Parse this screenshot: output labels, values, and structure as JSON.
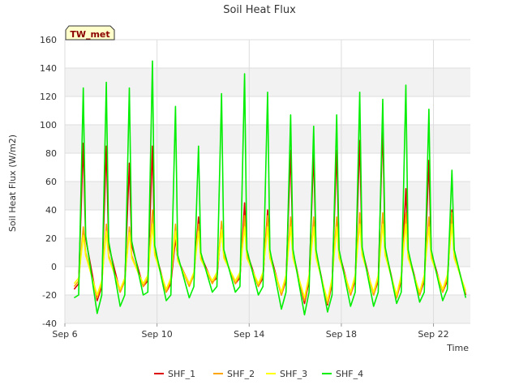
{
  "chart_data": {
    "type": "line",
    "title": "Soil Heat Flux",
    "xlabel": "Time",
    "ylabel": "Soil Heat Flux (W/m2)",
    "badge": "TW_met",
    "ylim": [
      -40,
      160
    ],
    "yticks": [
      -40,
      -20,
      0,
      20,
      40,
      60,
      80,
      100,
      120,
      140,
      160
    ],
    "xlim": [
      "Sep 6",
      "Sep 23.6"
    ],
    "xticks": [
      "Sep 6",
      "Sep 10",
      "Sep 14",
      "Sep 18",
      "Sep 22"
    ],
    "grid": true,
    "legend_position": "bottom",
    "x_dates": [
      "Sep 6.4",
      "Sep 6.6",
      "Sep 6.8",
      "Sep 6.9",
      "Sep 7.4",
      "Sep 7.6",
      "Sep 7.8",
      "Sep 7.9",
      "Sep 8.4",
      "Sep 8.6",
      "Sep 8.8",
      "Sep 8.9",
      "Sep 9.4",
      "Sep 9.6",
      "Sep 9.8",
      "Sep 9.9",
      "Sep 10.4",
      "Sep 10.6",
      "Sep 10.8",
      "Sep 10.9",
      "Sep 11.4",
      "Sep 11.6",
      "Sep 11.8",
      "Sep 11.9",
      "Sep 12.4",
      "Sep 12.6",
      "Sep 12.8",
      "Sep 12.9",
      "Sep 13.4",
      "Sep 13.6",
      "Sep 13.8",
      "Sep 13.9",
      "Sep 14.4",
      "Sep 14.6",
      "Sep 14.8",
      "Sep 14.9",
      "Sep 15.4",
      "Sep 15.6",
      "Sep 15.8",
      "Sep 15.9",
      "Sep 16.4",
      "Sep 16.6",
      "Sep 16.8",
      "Sep 16.9",
      "Sep 17.4",
      "Sep 17.6",
      "Sep 17.8",
      "Sep 17.9",
      "Sep 18.4",
      "Sep 18.6",
      "Sep 18.8",
      "Sep 18.9",
      "Sep 19.4",
      "Sep 19.6",
      "Sep 19.8",
      "Sep 19.9",
      "Sep 20.4",
      "Sep 20.6",
      "Sep 20.8",
      "Sep 20.9",
      "Sep 21.4",
      "Sep 21.6",
      "Sep 21.8",
      "Sep 21.9",
      "Sep 22.4",
      "Sep 22.6",
      "Sep 22.8",
      "Sep 22.9",
      "Sep 23.4"
    ],
    "x": [
      6.4,
      6.6,
      6.8,
      6.9,
      7.4,
      7.6,
      7.8,
      7.9,
      8.4,
      8.6,
      8.8,
      8.9,
      9.4,
      9.6,
      9.8,
      9.9,
      10.4,
      10.6,
      10.8,
      10.9,
      11.4,
      11.6,
      11.8,
      11.9,
      12.4,
      12.6,
      12.8,
      12.9,
      13.4,
      13.6,
      13.8,
      13.9,
      14.4,
      14.6,
      14.8,
      14.9,
      15.4,
      15.6,
      15.8,
      15.9,
      16.4,
      16.6,
      16.8,
      16.9,
      17.4,
      17.6,
      17.8,
      17.9,
      18.4,
      18.6,
      18.8,
      18.9,
      19.4,
      19.6,
      19.8,
      19.9,
      20.4,
      20.6,
      20.8,
      20.9,
      21.4,
      21.6,
      21.8,
      21.9,
      22.4,
      22.6,
      22.8,
      22.9,
      23.4
    ],
    "series": [
      {
        "name": "SHF_1",
        "color": "#dd0000",
        "values": [
          -16,
          -12,
          87,
          20,
          -24,
          -14,
          85,
          15,
          -18,
          -10,
          73,
          15,
          -14,
          -10,
          85,
          12,
          -18,
          -12,
          20,
          5,
          -12,
          -6,
          35,
          8,
          -11,
          -8,
          30,
          8,
          -12,
          -8,
          45,
          10,
          -14,
          -8,
          40,
          10,
          -20,
          -10,
          82,
          10,
          -26,
          -10,
          80,
          10,
          -27,
          -12,
          82,
          10,
          -20,
          -10,
          89,
          12,
          -20,
          -10,
          99,
          12,
          -22,
          -10,
          55,
          10,
          -20,
          -10,
          75,
          10,
          -18,
          -10,
          40,
          10,
          -20
        ]
      },
      {
        "name": "SHF_2",
        "color": "#ffa500",
        "values": [
          -14,
          -10,
          28,
          10,
          -22,
          -12,
          30,
          8,
          -18,
          -10,
          28,
          8,
          -14,
          -8,
          40,
          10,
          -18,
          -10,
          30,
          5,
          -14,
          -6,
          30,
          6,
          -12,
          -6,
          32,
          8,
          -12,
          -6,
          36,
          8,
          -14,
          -6,
          36,
          8,
          -20,
          -8,
          35,
          8,
          -24,
          -8,
          35,
          8,
          -26,
          -10,
          35,
          8,
          -20,
          -8,
          38,
          10,
          -20,
          -8,
          38,
          10,
          -22,
          -8,
          38,
          8,
          -20,
          -8,
          35,
          8,
          -18,
          -8,
          38,
          8,
          -19
        ]
      },
      {
        "name": "SHF_3",
        "color": "#ffff00",
        "values": [
          -12,
          -8,
          22,
          8,
          -20,
          -10,
          25,
          6,
          -16,
          -8,
          24,
          6,
          -12,
          -6,
          30,
          8,
          -16,
          -8,
          25,
          4,
          -12,
          -4,
          25,
          5,
          -10,
          -4,
          26,
          6,
          -10,
          -4,
          28,
          6,
          -12,
          -4,
          28,
          6,
          -18,
          -6,
          28,
          6,
          -22,
          -6,
          28,
          6,
          -24,
          -8,
          28,
          6,
          -18,
          -6,
          30,
          8,
          -18,
          -6,
          30,
          8,
          -20,
          -6,
          30,
          6,
          -18,
          -6,
          28,
          6,
          -16,
          -6,
          30,
          6,
          -17
        ]
      },
      {
        "name": "SHF_4",
        "color": "#00ee00",
        "values": [
          -22,
          -20,
          126,
          22,
          -33,
          -20,
          130,
          18,
          -28,
          -20,
          126,
          18,
          -20,
          -18,
          145,
          15,
          -24,
          -20,
          113,
          8,
          -22,
          -14,
          85,
          10,
          -18,
          -14,
          122,
          12,
          -18,
          -14,
          136,
          12,
          -20,
          -14,
          123,
          12,
          -30,
          -18,
          107,
          12,
          -34,
          -18,
          99,
          12,
          -32,
          -20,
          107,
          12,
          -28,
          -18,
          123,
          14,
          -28,
          -18,
          118,
          14,
          -26,
          -18,
          128,
          12,
          -25,
          -18,
          111,
          12,
          -24,
          -16,
          68,
          12,
          -22
        ]
      }
    ]
  }
}
